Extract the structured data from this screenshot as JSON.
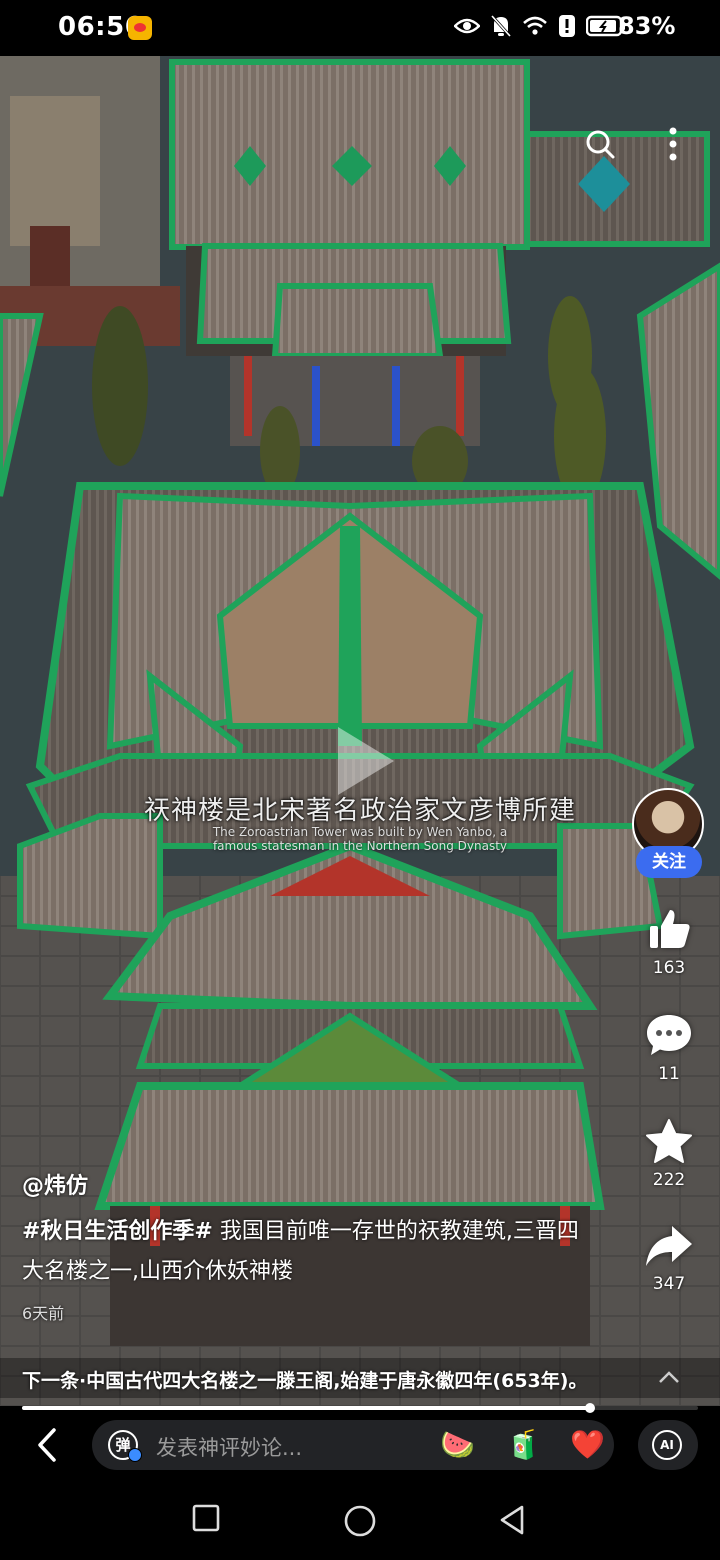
{
  "status_bar": {
    "time": "06:56",
    "battery": "83%"
  },
  "video": {
    "subtitle_zh": "祆神楼是北宋著名政治家文彦博所建",
    "subtitle_en": "The Zoroastrian Tower was built by Wen Yanbo, a famous statesman in the Northern Song Dynasty"
  },
  "rail": {
    "follow_label": "关注",
    "likes": "163",
    "comments": "11",
    "favorites": "222",
    "shares": "347"
  },
  "caption": {
    "author": "@炜仿",
    "hashtag": "#秋日生活创作季#",
    "text": " 我国目前唯一存世的祆教建筑,三晋四大名楼之一,山西介休妖神楼",
    "time_ago": "6天前"
  },
  "next": {
    "text": "下一条·中国古代四大名楼之一滕王阁,始建于唐永徽四年(653年)。"
  },
  "progress": {
    "fraction": 0.84
  },
  "comment_bar": {
    "danmu_label": "弹",
    "placeholder": "发表神评妙论...",
    "emoji_1": "🍉",
    "emoji_2": "🧃",
    "emoji_3": "❤️",
    "ai_label": "AI"
  },
  "colors": {
    "follow_bg": "#3b6cf0",
    "roof_green": "#1fa35a",
    "heart": "#e8322c"
  }
}
